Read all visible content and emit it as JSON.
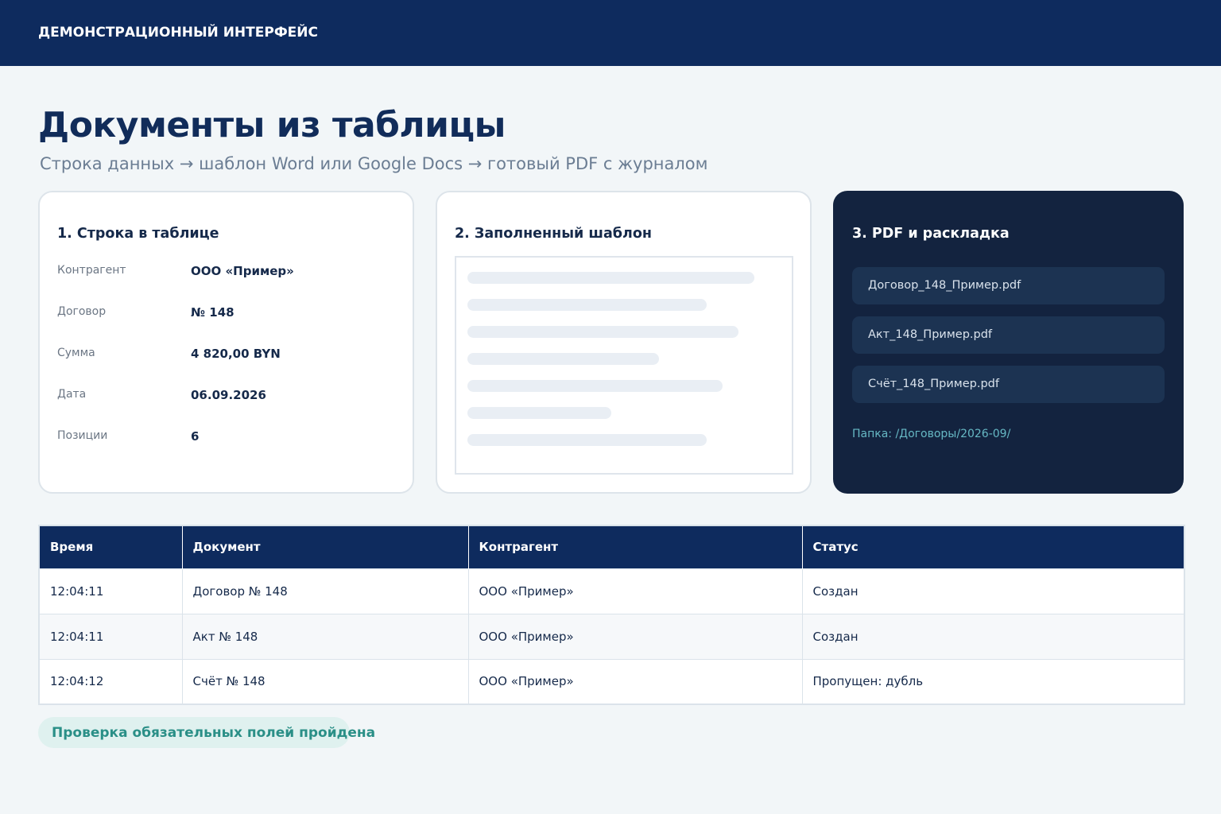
{
  "header": {
    "brand": "ДЕМОНСТРАЦИОННЫЙ ИНТЕРФЕЙС"
  },
  "page": {
    "title": "Документы из таблицы",
    "subtitle": "Строка данных → шаблон Word или Google Docs → готовый PDF с журналом"
  },
  "card_row": {
    "title": "1. Строка в таблице",
    "fields": [
      {
        "label": "Контрагент",
        "value": "ООО «Пример»"
      },
      {
        "label": "Договор",
        "value": "№ 148"
      },
      {
        "label": "Сумма",
        "value": "4 820,00 BYN"
      },
      {
        "label": "Дата",
        "value": "06.09.2026"
      },
      {
        "label": "Позиции",
        "value": "6"
      }
    ]
  },
  "card_template": {
    "title": "2. Заполненный шаблон"
  },
  "card_pdf": {
    "title": "3. PDF и раскладка",
    "files": [
      "Договор_148_Пример.pdf",
      "Акт_148_Пример.pdf",
      "Счёт_148_Пример.pdf"
    ],
    "folder": "Папка: /Договоры/2026-09/"
  },
  "log": {
    "columns": [
      "Время",
      "Документ",
      "Контрагент",
      "Статус"
    ],
    "rows": [
      {
        "time": "12:04:11",
        "document": "Договор № 148",
        "counterparty": "ООО «Пример»",
        "status": "Создан"
      },
      {
        "time": "12:04:11",
        "document": "Акт № 148",
        "counterparty": "ООО «Пример»",
        "status": "Создан"
      },
      {
        "time": "12:04:12",
        "document": "Счёт № 148",
        "counterparty": "ООО «Пример»",
        "status": "Пропущен: дубль"
      }
    ]
  },
  "validation": {
    "message": "Проверка обязательных полей пройдена"
  },
  "colors": {
    "header_bg": "#0e2b5e",
    "dark_card_bg": "#13233f",
    "success_bg": "#dff1ef",
    "success_text": "#2a8f87",
    "folder_text": "#66b8c4"
  }
}
